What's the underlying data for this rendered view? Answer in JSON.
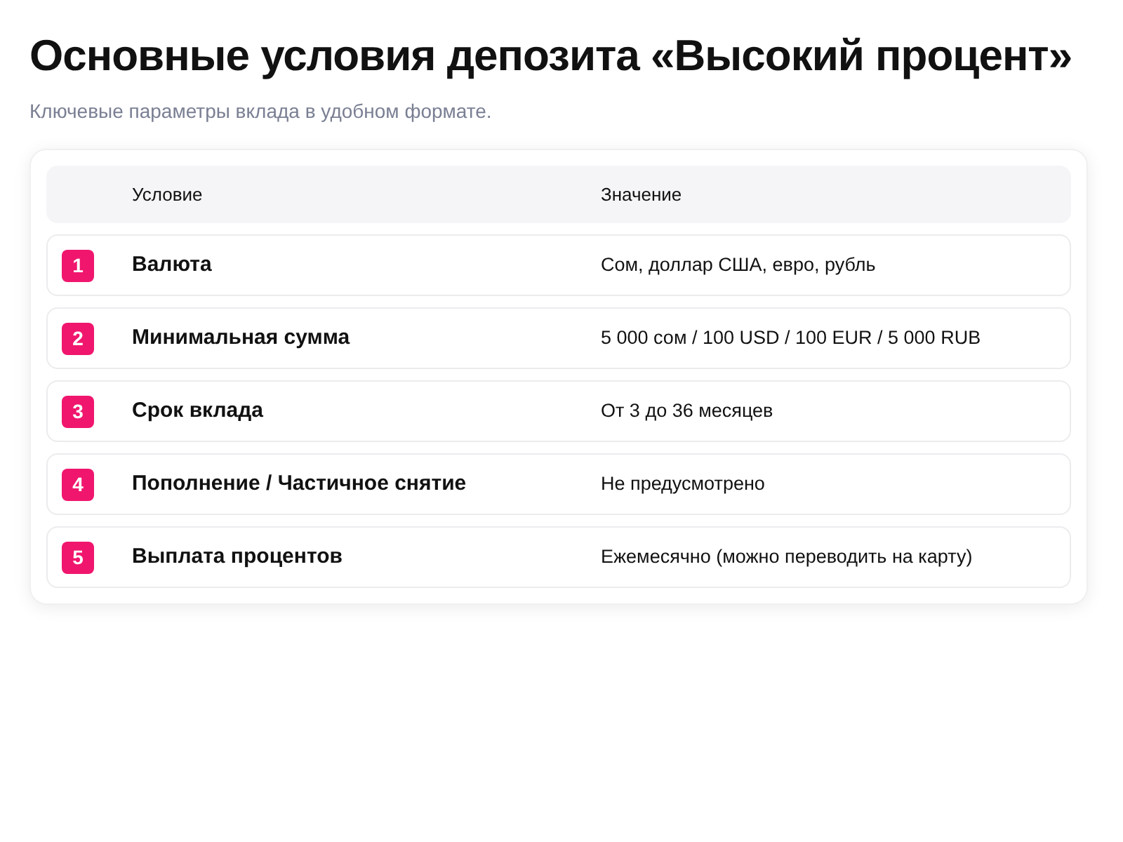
{
  "title": "Основные условия депозита «Высокий процент»",
  "subtitle": "Ключевые параметры вклада в удобном формате.",
  "table": {
    "columns": [
      "Условие",
      "Значение"
    ],
    "rows": [
      {
        "number": "1",
        "condition": "Валюта",
        "value": "Сом, доллар США, евро, рубль"
      },
      {
        "number": "2",
        "condition": "Минимальная сумма",
        "value": "5 000 сом / 100 USD / 100 EUR / 5 000 RUB"
      },
      {
        "number": "3",
        "condition": "Срок вклада",
        "value": "От 3 до 36 месяцев"
      },
      {
        "number": "4",
        "condition": "Пополнение / Частичное снятие",
        "value": "Не предусмотрено"
      },
      {
        "number": "5",
        "condition": "Выплата процентов",
        "value": "Ежемесячно (можно переводить на карту)"
      }
    ]
  }
}
